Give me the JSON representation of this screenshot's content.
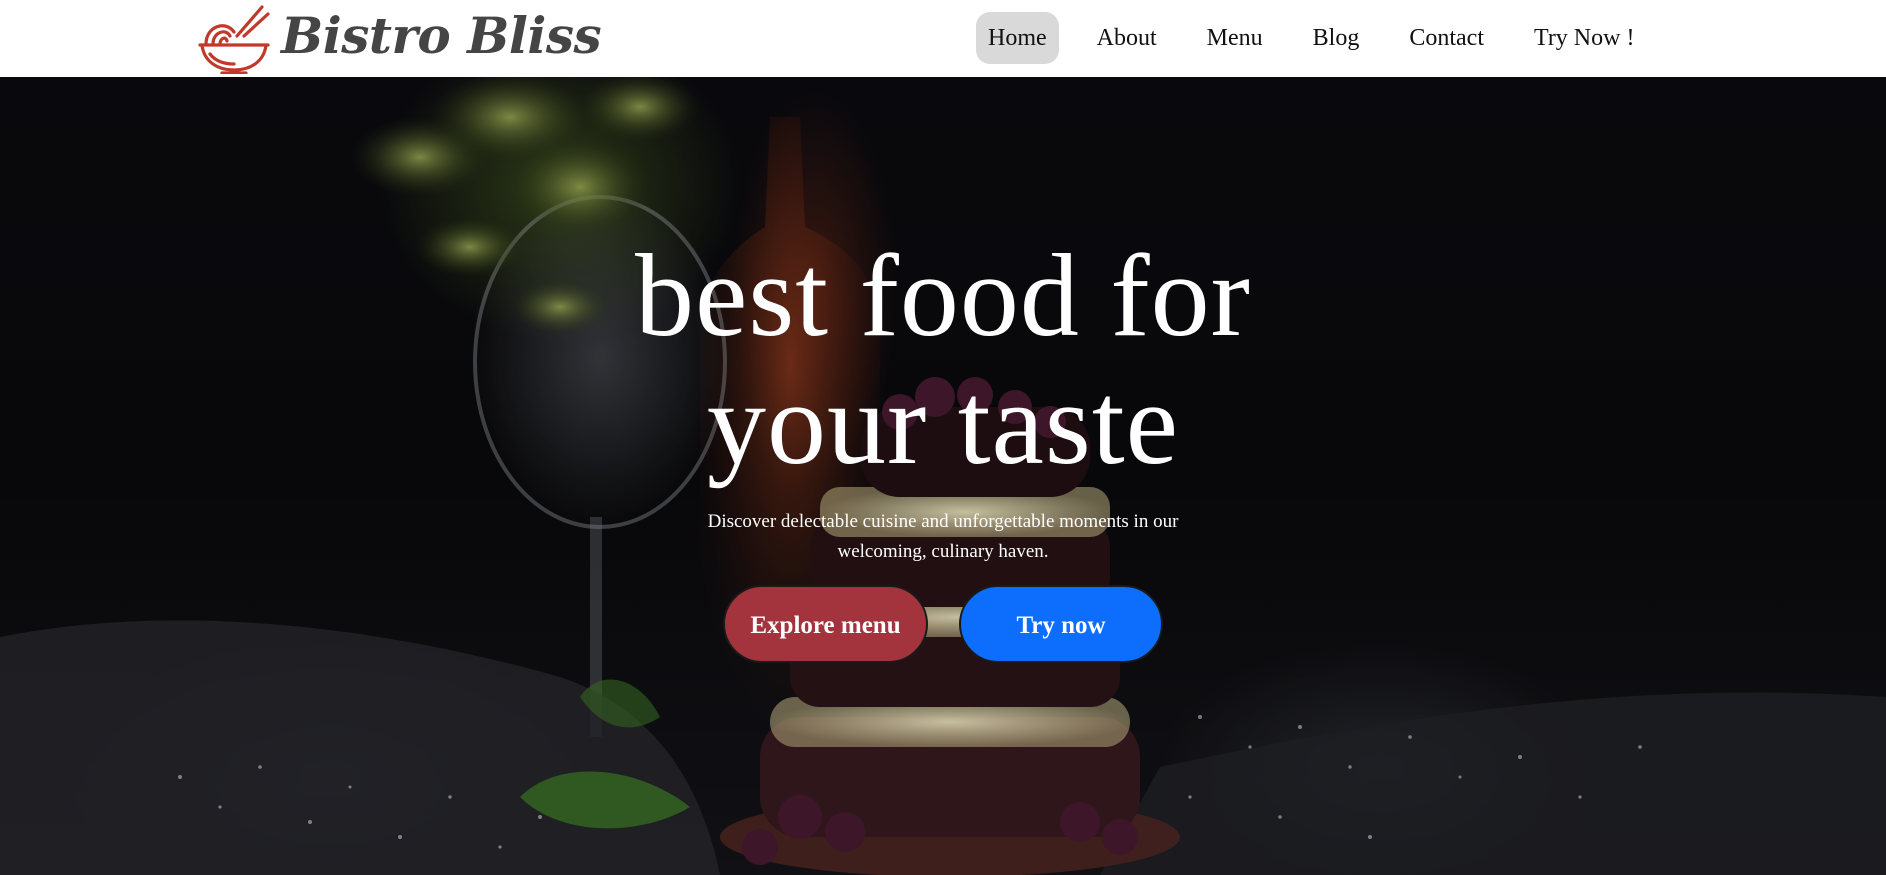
{
  "brand": {
    "name": "Bistro Bliss",
    "logo_icon": "noodle-bowl-icon",
    "accent_color": "#c0392b"
  },
  "nav": {
    "items": [
      {
        "label": "Home",
        "active": true
      },
      {
        "label": "About",
        "active": false
      },
      {
        "label": "Menu",
        "active": false
      },
      {
        "label": "Blog",
        "active": false
      },
      {
        "label": "Contact",
        "active": false
      },
      {
        "label": "Try Now !",
        "active": false
      }
    ]
  },
  "hero": {
    "title_line1": "best food for",
    "title_line2": "your taste",
    "subtitle_line1": "Discover delectable cuisine and unforgettable moments in our",
    "subtitle_line2": "welcoming, culinary haven.",
    "buttons": {
      "explore_label": "Explore menu",
      "explore_color": "#a3333d",
      "try_label": "Try now",
      "try_color": "#0d6efd"
    }
  }
}
